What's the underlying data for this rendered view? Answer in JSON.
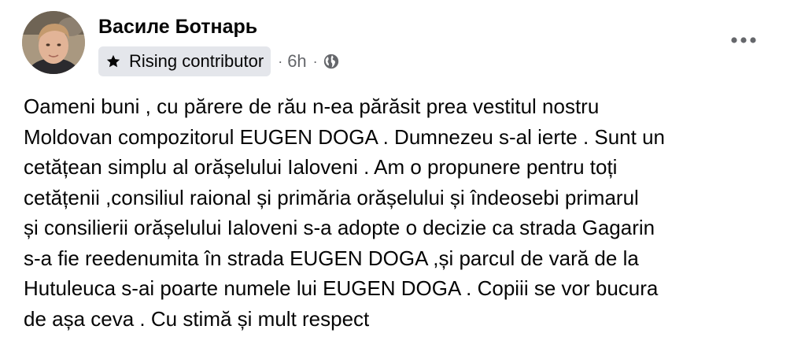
{
  "post": {
    "author": {
      "name": "Василе Ботнарь",
      "badge": {
        "icon": "star-icon",
        "label": "Rising contributor"
      }
    },
    "meta": {
      "separator": "·",
      "time": "6h",
      "audience_icon": "globe-icon"
    },
    "menu_icon": "more-horizontal-icon",
    "text": "Oameni buni , cu părere de rău n-ea părăsit prea vestitul nostru\nMoldovan compozitorul EUGEN DOGA . Dumnezeu s-al ierte . Sunt un\ncetățean simplu al orășelului Ialoveni . Am o propunere pentru toți\ncetățenii ,consiliul raional și primăria orășelului și îndeosebi primarul\nși consilierii orășelului Ialoveni s-a adopte o decizie ca strada Gagarin\ns-a fie reedenumita în strada EUGEN DOGA ,și parcul de vară de la\nHutuleuca s-ai poarte numele lui EUGEN DOGA . Copiii se vor bucura\nde așa ceva . Cu stimă și mult respect"
  },
  "colors": {
    "text_primary": "#050505",
    "text_secondary": "#65676b",
    "badge_background": "#e4e6eb",
    "page_background": "#ffffff"
  }
}
